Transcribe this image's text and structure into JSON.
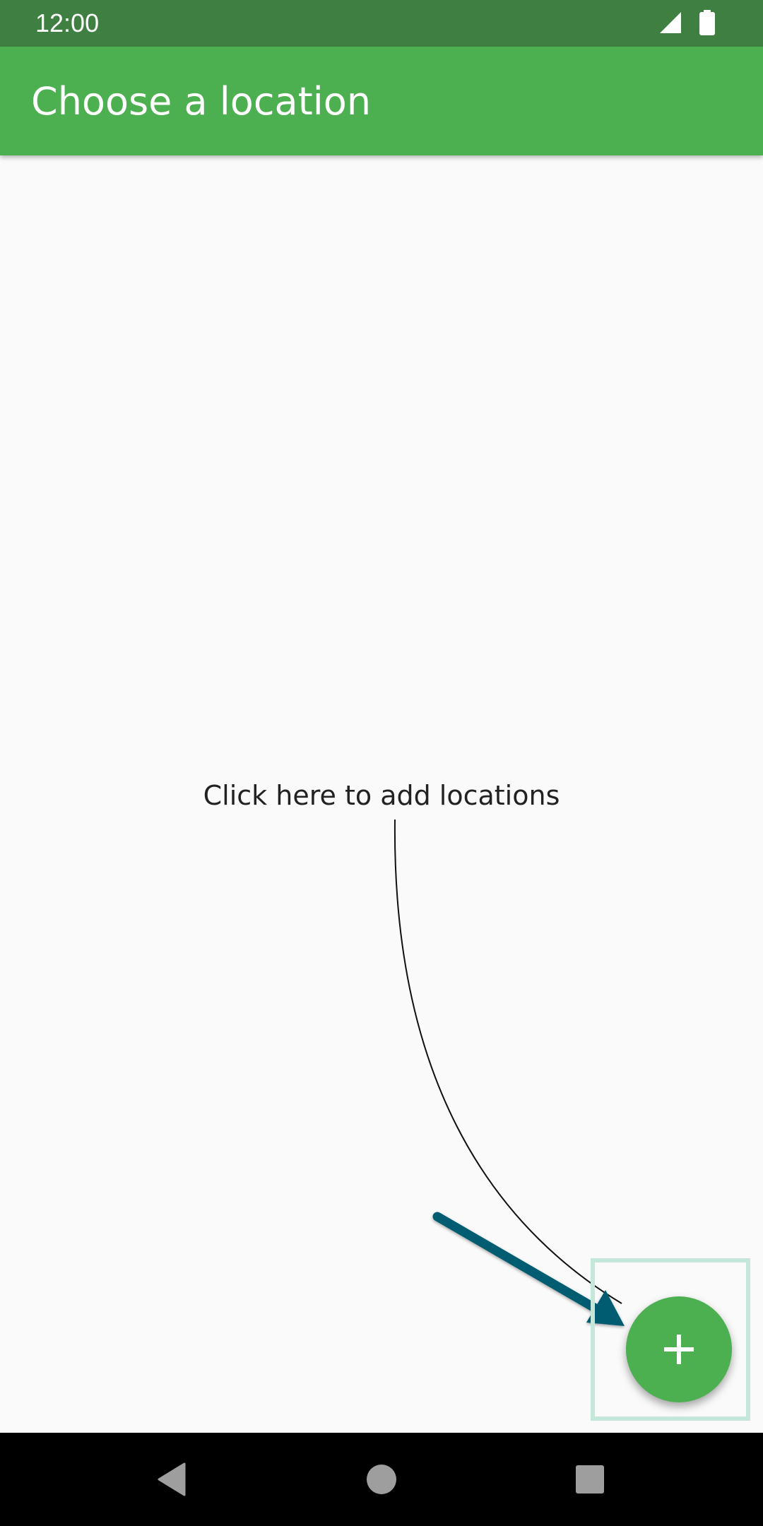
{
  "status_bar": {
    "time": "12:00",
    "icons": [
      "signal-icon",
      "battery-icon"
    ],
    "background": "#3f7f42"
  },
  "app_bar": {
    "title": "Choose a location",
    "background": "#4caf50"
  },
  "content": {
    "hint": "Click here to add locations"
  },
  "fab": {
    "icon": "plus-icon",
    "color": "#4caf50"
  },
  "annotation": {
    "arrow_color": "#005c70",
    "highlight_color": "#c3e7d9"
  },
  "nav_bar": {
    "buttons": [
      "back-icon",
      "home-icon",
      "recents-icon"
    ]
  }
}
